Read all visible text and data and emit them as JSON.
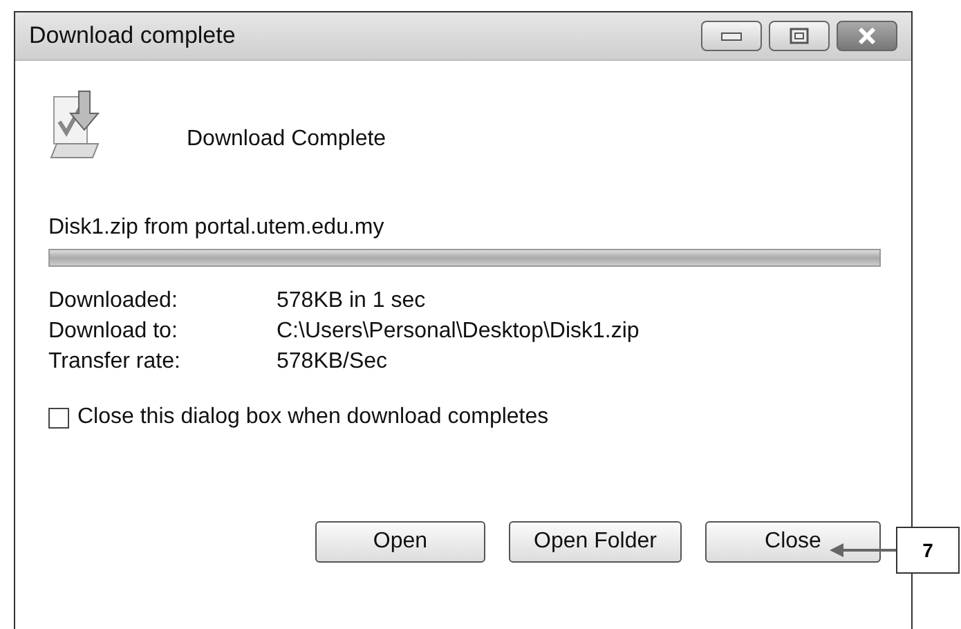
{
  "window": {
    "title": "Download complete"
  },
  "heading": "Download Complete",
  "source": "Disk1.zip from portal.utem.edu.my",
  "progress": {
    "level": 1
  },
  "details": [
    {
      "label": "Downloaded:",
      "value": "578KB in 1 sec"
    },
    {
      "label": "Download to:",
      "value": "C:\\Users\\Personal\\Desktop\\Disk1.zip"
    },
    {
      "label": "Transfer rate:",
      "value": "578KB/Sec"
    }
  ],
  "option": {
    "label": "Close this dialog box when download completes",
    "checked": false
  },
  "buttons": [
    "Open",
    "Open Folder",
    "Close"
  ],
  "callout": {
    "label": "7"
  }
}
